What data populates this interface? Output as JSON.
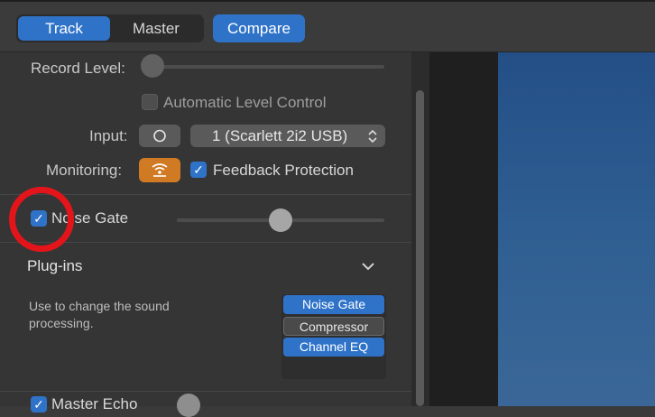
{
  "toolbar": {
    "track_label": "Track",
    "master_label": "Master",
    "compare_label": "Compare"
  },
  "recording": {
    "record_level_label": "Record Level:",
    "record_level_value": 0.0,
    "auto_level_control_label": "Automatic Level Control",
    "auto_level_control_checked": false,
    "input_label": "Input:",
    "input_mono_icon": "circle-icon",
    "input_device_value": "1  (Scarlett 2i2 USB)",
    "monitoring_label": "Monitoring:",
    "monitoring_icon": "monitoring-waves-icon",
    "monitoring_on": true,
    "feedback_protection_label": "Feedback Protection",
    "feedback_protection_checked": true
  },
  "noise_gate": {
    "label": "Noise Gate",
    "checked": true,
    "threshold_value": 0.5
  },
  "plugins": {
    "header_label": "Plug-ins",
    "description": "Use to change the sound processing.",
    "slots": [
      {
        "label": "Noise Gate",
        "active": true
      },
      {
        "label": "Compressor",
        "active": false
      },
      {
        "label": "Channel EQ",
        "active": true
      }
    ]
  },
  "master_echo": {
    "label": "Master Echo",
    "checked": true
  },
  "colors": {
    "accent": "#2f73c9",
    "monitoring": "#d07a24",
    "annotation": "#e3151b"
  }
}
